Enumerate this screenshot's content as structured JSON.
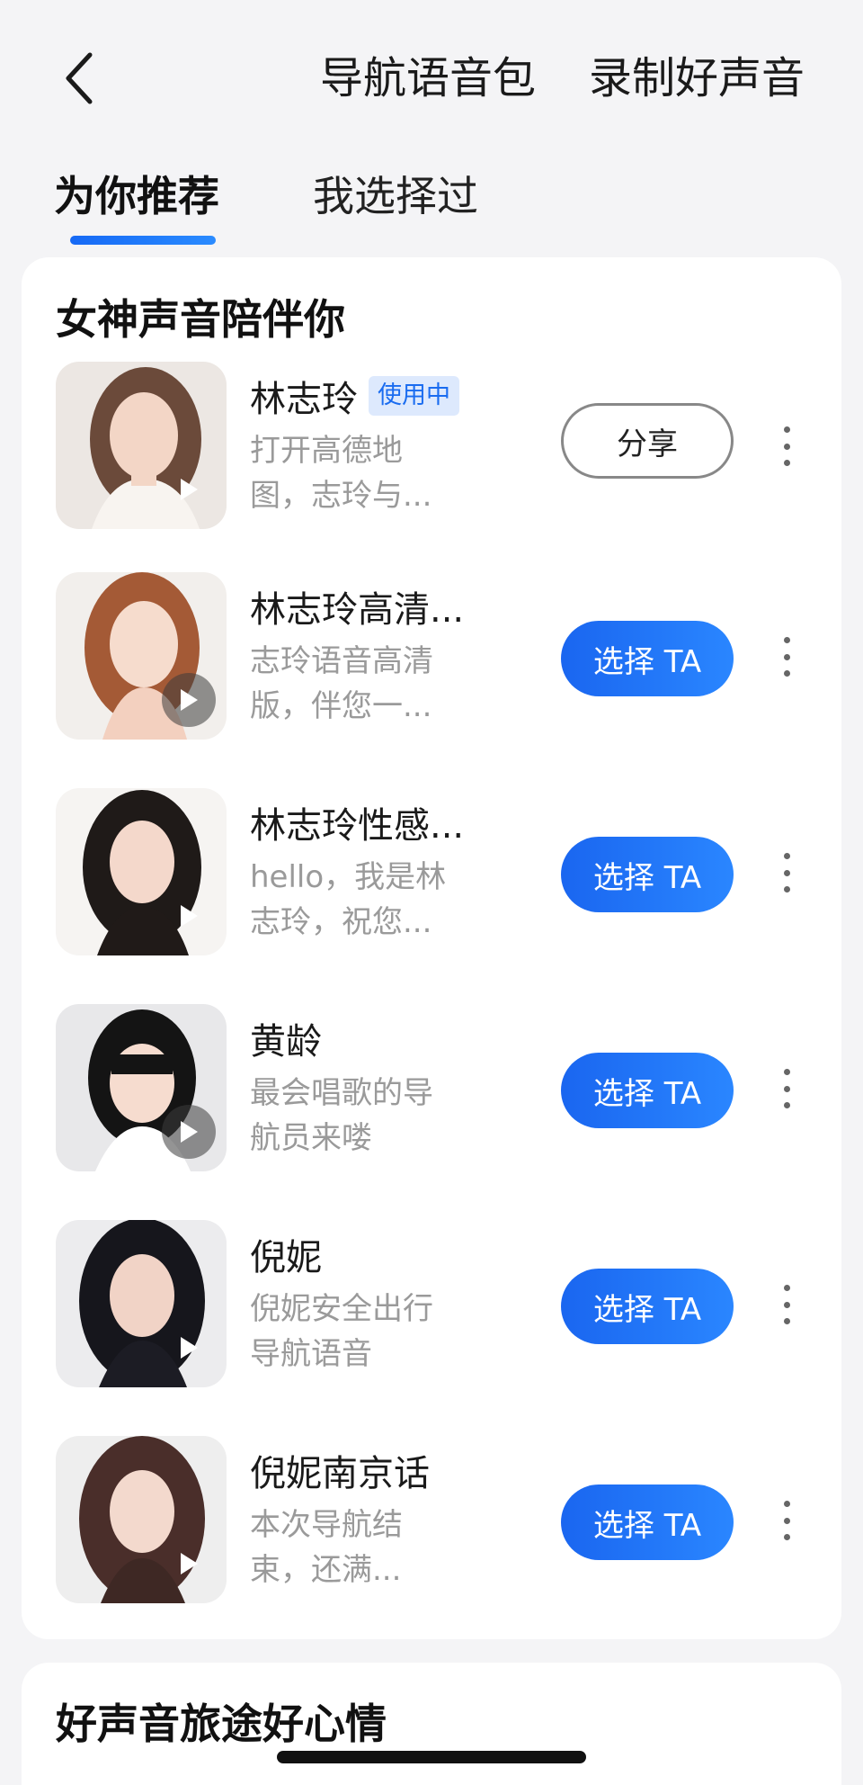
{
  "header": {
    "voice_pack_label": "导航语音包",
    "record_label": "录制好声音"
  },
  "tabs": [
    {
      "label": "为你推荐",
      "active": true
    },
    {
      "label": "我选择过",
      "active": false
    }
  ],
  "sections": [
    {
      "title": "女神声音陪伴你",
      "items": [
        {
          "name": "林志玲",
          "badge": "使用中",
          "desc_line1": "打开高德地",
          "desc_line2": "图，志玲与...",
          "action": "分享"
        },
        {
          "name": "林志玲高清...",
          "badge": "",
          "desc_line1": "志玲语音高清",
          "desc_line2": "版，伴您一...",
          "action": "选择 TA"
        },
        {
          "name": "林志玲性感...",
          "badge": "",
          "desc_line1": "hello，我是林",
          "desc_line2": "志玲，祝您...",
          "action": "选择 TA"
        },
        {
          "name": "黄龄",
          "badge": "",
          "desc_line1": "最会唱歌的导",
          "desc_line2": "航员来喽",
          "action": "选择 TA"
        },
        {
          "name": "倪妮",
          "badge": "",
          "desc_line1": "倪妮安全出行",
          "desc_line2": "导航语音",
          "action": "选择 TA"
        },
        {
          "name": "倪妮南京话",
          "badge": "",
          "desc_line1": "本次导航结",
          "desc_line2": "束，还满...",
          "action": "选择 TA"
        }
      ]
    },
    {
      "title": "好声音旅途好心情",
      "items": []
    }
  ],
  "colors": {
    "accent": "#1a66f0",
    "badge_bg": "#dde9fd",
    "page_bg": "#f4f4f6"
  },
  "icons": {
    "back": "chevron-left-icon",
    "play": "play-icon",
    "more": "more-vertical-icon"
  }
}
